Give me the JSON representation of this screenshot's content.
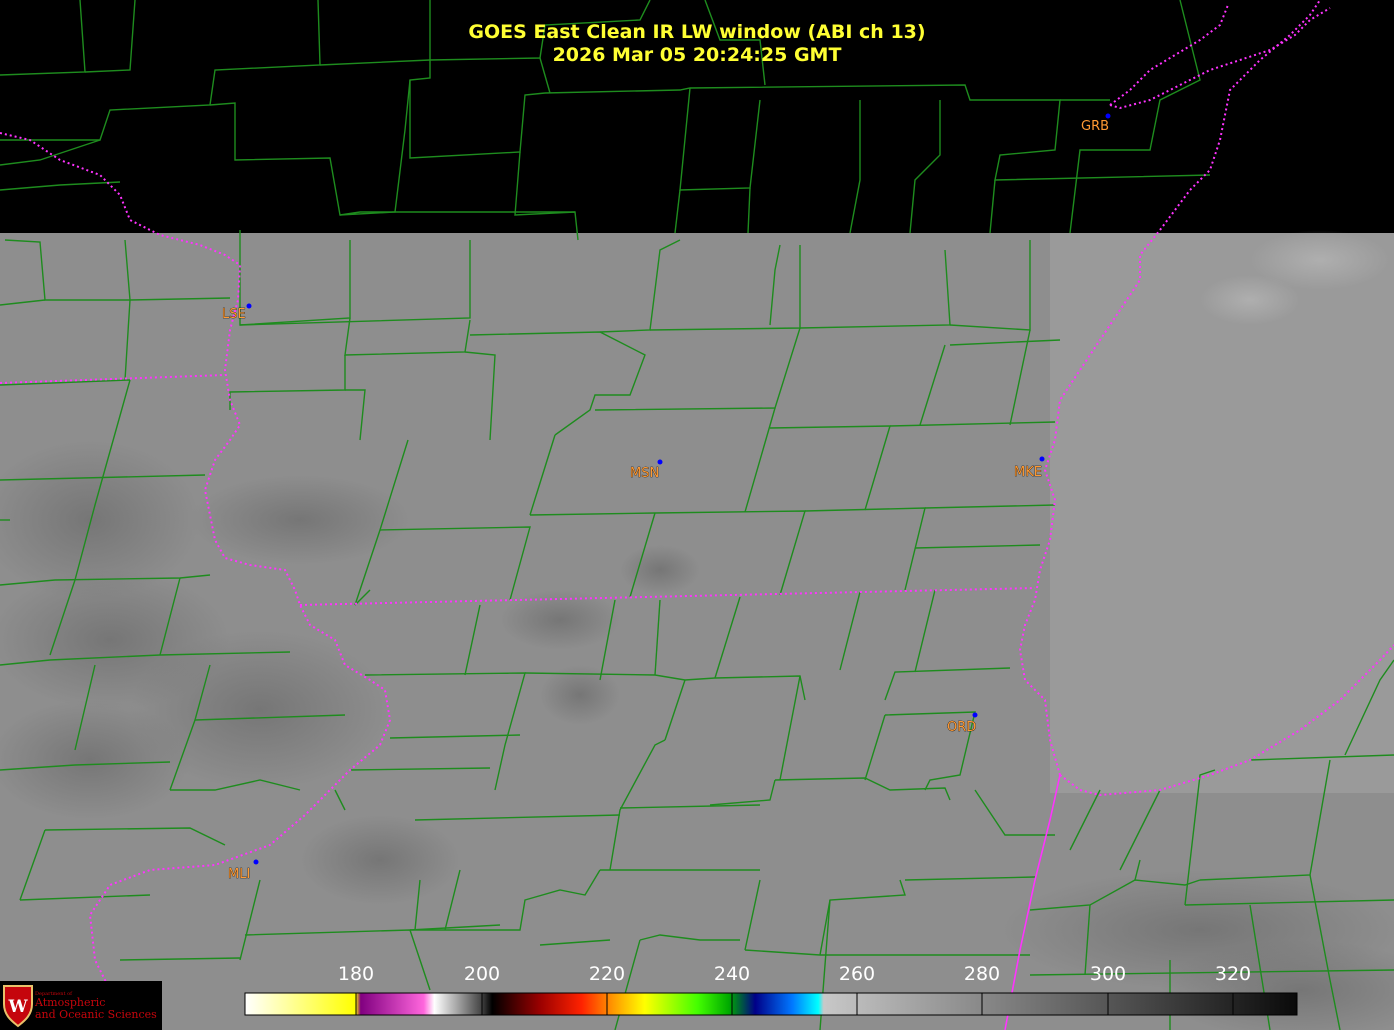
{
  "title": {
    "line1": "GOES East Clean IR LW window (ABI ch 13)",
    "line2": "2026 Mar 05  20:24:25 GMT"
  },
  "colors": {
    "title": "#ffff33",
    "county_lines": "#1e8c1e",
    "state_lines": "#ff33ff",
    "station_label": "#ff9a33",
    "station_dot": "#0000ff",
    "no_data": "#000000"
  },
  "stations": [
    {
      "code": "GRB"
    },
    {
      "code": "LSE"
    },
    {
      "code": "MSN"
    },
    {
      "code": "MKE"
    },
    {
      "code": "ORD"
    },
    {
      "code": "MLI"
    }
  ],
  "colorbar": {
    "ticks": [
      "180",
      "200",
      "220",
      "240",
      "260",
      "280",
      "300",
      "320"
    ]
  },
  "logo": {
    "icon": "uw-crest-icon",
    "dept": "Department of",
    "line1": "Atmospheric",
    "line2": "and Oceanic Sciences"
  }
}
